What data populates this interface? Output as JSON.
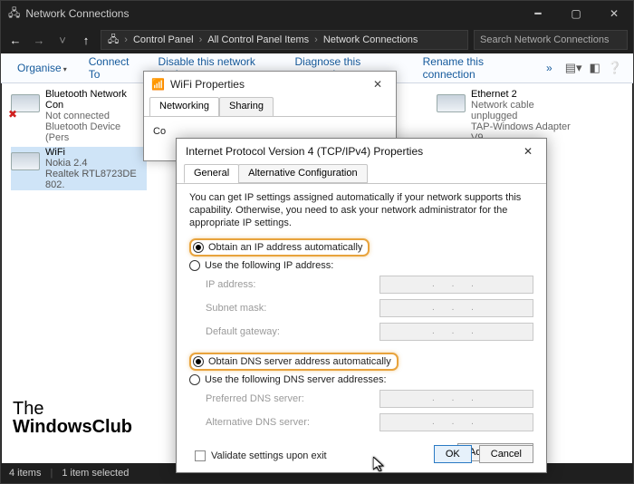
{
  "window": {
    "title": "Network Connections",
    "breadcrumbs": [
      "Control Panel",
      "All Control Panel Items",
      "Network Connections"
    ],
    "search_placeholder": "Search Network Connections"
  },
  "commands": {
    "organise": "Organise",
    "connect_to": "Connect To",
    "disable": "Disable this network device",
    "diagnose": "Diagnose this connection",
    "rename": "Rename this connection",
    "more": "»"
  },
  "connections": [
    {
      "name": "Bluetooth Network Con",
      "status": "Not connected",
      "device": "Bluetooth Device (Pers",
      "error": true
    },
    {
      "name": "Ethernet 2",
      "status": "Network cable unplugged",
      "device": "TAP-Windows Adapter V9",
      "error": false
    },
    {
      "name": "WiFi",
      "status": "Nokia 2.4",
      "device": "Realtek RTL8723DE 802.",
      "error": false
    }
  ],
  "watermark": {
    "line1": "The",
    "line2": "WindowsClub"
  },
  "status_bar": {
    "items": "4 items",
    "selected": "1 item selected"
  },
  "dlg_mid": {
    "title": "WiFi Properties",
    "tabs": [
      "Networking",
      "Sharing"
    ],
    "body_label": "Co"
  },
  "dlg": {
    "title": "Internet Protocol Version 4 (TCP/IPv4) Properties",
    "tabs": [
      "General",
      "Alternative Configuration"
    ],
    "intro": "You can get IP settings assigned automatically if your network supports this capability. Otherwise, you need to ask your network administrator for the appropriate IP settings.",
    "r_auto_ip": "Obtain an IP address automatically",
    "r_use_ip": "Use the following IP address:",
    "lbl_ip": "IP address:",
    "lbl_mask": "Subnet mask:",
    "lbl_gw": "Default gateway:",
    "r_auto_dns": "Obtain DNS server address automatically",
    "r_use_dns": "Use the following DNS server addresses:",
    "lbl_pref": "Preferred DNS server:",
    "lbl_alt": "Alternative DNS server:",
    "chk_validate": "Validate settings upon exit",
    "btn_adv": "Advanced...",
    "btn_ok": "OK",
    "btn_cancel": "Cancel",
    "ip_blank": ".     .     ."
  }
}
